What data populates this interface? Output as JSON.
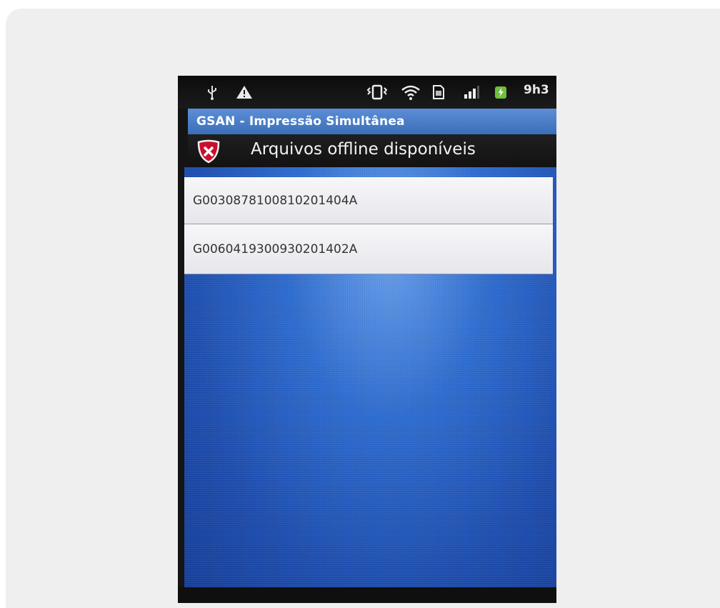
{
  "status_bar": {
    "time": "9h3",
    "icons": [
      "usb-icon",
      "warning-icon",
      "vibrate-icon",
      "wifi-icon",
      "sd-card-icon",
      "signal-icon",
      "battery-icon"
    ]
  },
  "app": {
    "title": "GSAN - Impressão Simultânea"
  },
  "dialog": {
    "title": "Arquivos offline disponíveis",
    "items": [
      {
        "label": "G0030878100810201404A"
      },
      {
        "label": "G0060419300930201402A"
      }
    ]
  },
  "colors": {
    "title_bar": "#4a7fc8",
    "list_background": "#2f6dd0",
    "item_background": "#f2f2f5"
  }
}
